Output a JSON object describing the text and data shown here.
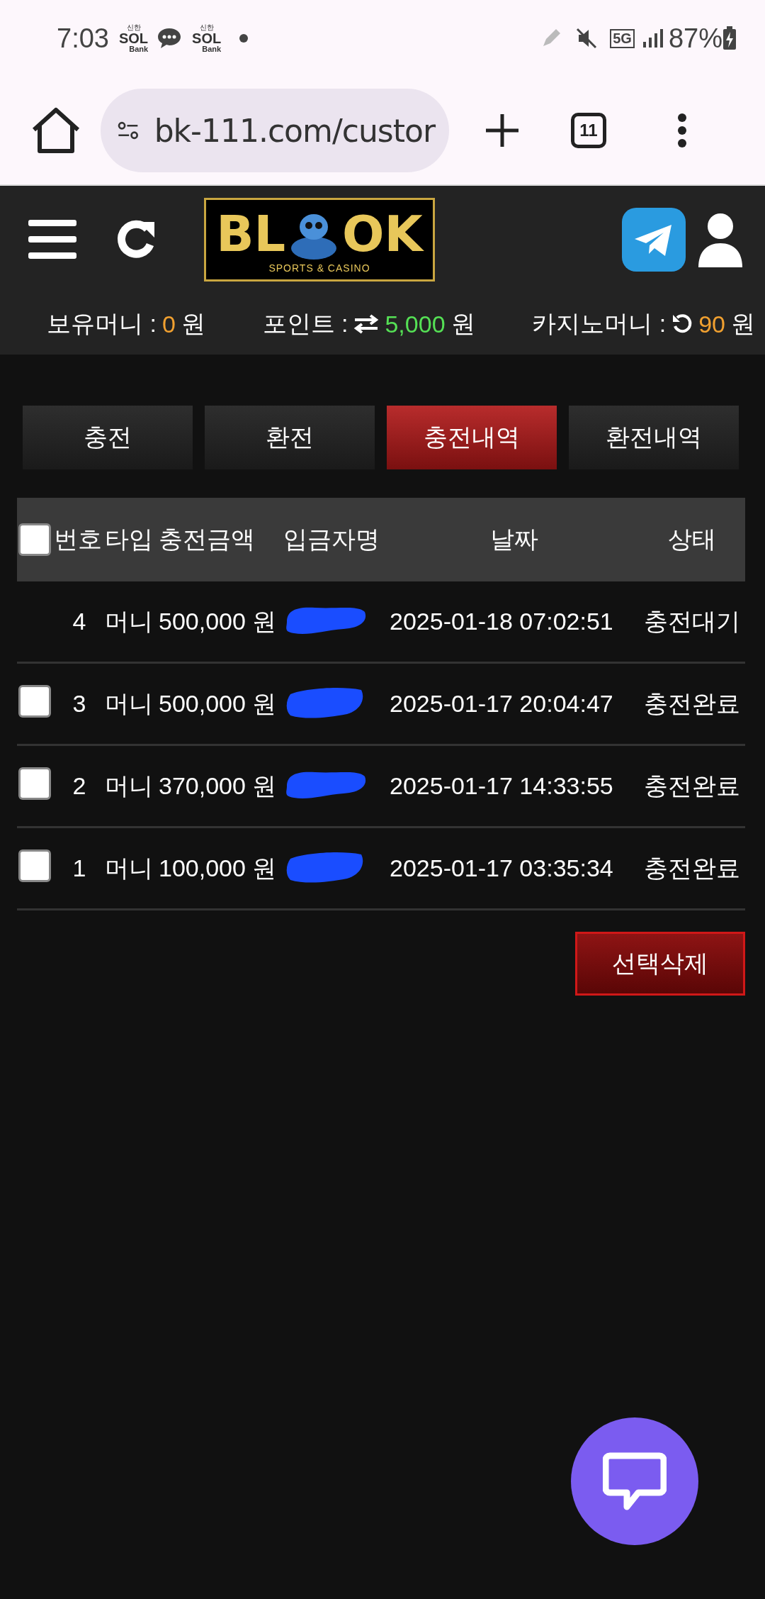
{
  "status_bar": {
    "time": "7:03",
    "notifications": [
      {
        "kind": "bank",
        "top": "신한",
        "main": "SOL",
        "sub": "Bank"
      },
      {
        "kind": "chat"
      },
      {
        "kind": "bank",
        "top": "신한",
        "main": "SOL",
        "sub": "Bank"
      },
      {
        "kind": "dot"
      }
    ],
    "network": "5G",
    "battery": "87%"
  },
  "browser": {
    "url": "bk-111.com/custor",
    "tab_count": "11"
  },
  "logo": {
    "left": "BL",
    "right": "OK",
    "tagline": "SPORTS & CASINO"
  },
  "balances": [
    {
      "label": "보유머니 :",
      "kind": "plain",
      "value": "0",
      "unit": "원",
      "color": "#f0a030"
    },
    {
      "label": "포인트 :",
      "kind": "exchange",
      "value": "5,000",
      "unit": "원",
      "color": "#55e055"
    },
    {
      "label": "카지노머니 :",
      "kind": "refresh",
      "value": "90",
      "unit": "원",
      "color": "#f0a030"
    }
  ],
  "tabs": [
    {
      "label": "충전",
      "selected": false
    },
    {
      "label": "환전",
      "selected": false
    },
    {
      "label": "충전내역",
      "selected": true
    },
    {
      "label": "환전내역",
      "selected": false
    }
  ],
  "table": {
    "select_all_checked": false,
    "columns": [
      "번호",
      "타입",
      "충전금액",
      "입금자명",
      "날짜",
      "상태"
    ],
    "rows": [
      {
        "selectable": false,
        "no": "4",
        "type": "머니",
        "amount": "500,000 원",
        "date": "2025-01-18 07:02:51",
        "status": "충전대기"
      },
      {
        "selectable": true,
        "checked": false,
        "no": "3",
        "type": "머니",
        "amount": "500,000 원",
        "date": "2025-01-17 20:04:47",
        "status": "충전완료"
      },
      {
        "selectable": true,
        "checked": false,
        "no": "2",
        "type": "머니",
        "amount": "370,000 원",
        "date": "2025-01-17 14:33:55",
        "status": "충전완료"
      },
      {
        "selectable": true,
        "checked": false,
        "no": "1",
        "type": "머니",
        "amount": "100,000 원",
        "date": "2025-01-17 03:35:34",
        "status": "충전완료"
      }
    ]
  },
  "delete_button": "선택삭제"
}
